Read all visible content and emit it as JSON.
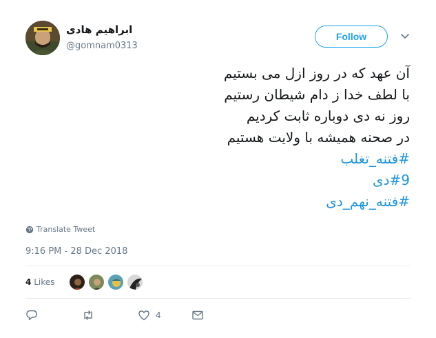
{
  "author": {
    "display_name": "ابراهیم هادی",
    "handle": "@gomnam0313"
  },
  "header": {
    "follow_label": "Follow"
  },
  "tweet": {
    "lines": [
      "آن عهد که در روز ازل می بستیم",
      "با لطف خدا ز دام شیطان رستیم",
      "روز نه دی دوباره ثابت کردیم",
      "در صحنه همیشه با ولایت هستیم"
    ],
    "hashtags": [
      "#فتنه_تغلب",
      "#9دی",
      "#فتنه_نهم_دی"
    ]
  },
  "translate_label": "Translate Tweet",
  "timestamp": "9:16 PM - 28 Dec 2018",
  "likes": {
    "count": "4",
    "label": "Likes"
  },
  "actions": {
    "reply_icon": "reply-icon",
    "retweet_icon": "retweet-icon",
    "like_icon": "heart-icon",
    "like_count": "4",
    "dm_icon": "envelope-icon"
  },
  "colors": {
    "accent": "#1da1f2",
    "hashtag": "#1b95e0",
    "muted": "#657786",
    "text": "#14171a",
    "divider": "#e6ecf0"
  }
}
